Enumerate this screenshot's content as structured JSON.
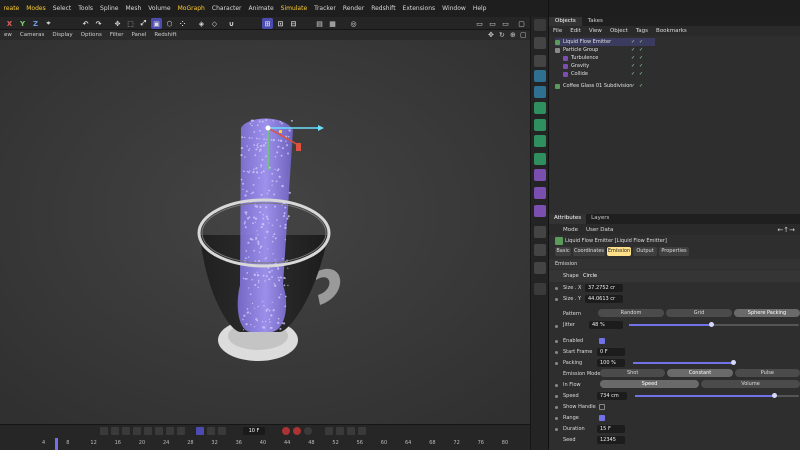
{
  "menubar": [
    "reate",
    "Modes",
    "Select",
    "Tools",
    "Spline",
    "Mesh",
    "Volume",
    "MoGraph",
    "Character",
    "Animate",
    "Simulate",
    "Tracker",
    "Render",
    "Redshift",
    "Extensions",
    "Window",
    "Help"
  ],
  "submenu": [
    "ew",
    "Cameras",
    "Display",
    "Options",
    "Filter",
    "Panel",
    "Redshift"
  ],
  "axis": {
    "x": "X",
    "y": "Y",
    "z": "Z"
  },
  "objects": {
    "tabs": [
      "Objects",
      "Takes"
    ],
    "menu": [
      "File",
      "Edit",
      "View",
      "Object",
      "Tags",
      "Bookmarks"
    ],
    "items": [
      {
        "name": "Liquid Flow Emitter",
        "selected": true
      },
      {
        "name": "Particle Group",
        "selected": false
      },
      {
        "name": "Turbulence",
        "selected": false
      },
      {
        "name": "Gravity",
        "selected": false
      },
      {
        "name": "Collide",
        "selected": false
      },
      {
        "name": "Coffee Glass 01 Subdivision",
        "selected": false
      }
    ]
  },
  "attributes": {
    "tabs": [
      "Attributes",
      "Layers"
    ],
    "menu": [
      "Mode",
      "User Data"
    ],
    "object_title": "Liquid Flow Emitter [Liquid Flow Emitter]",
    "section_tabs": [
      "Basic",
      "Coordinates",
      "Emission",
      "Output",
      "Properties"
    ],
    "active_section_tab": "Emission",
    "section_heading": "Emission",
    "shape_label": "Shape",
    "shape_value": "Circle",
    "size_x_label": "Size . X",
    "size_x_value": "37.2752 cr",
    "size_y_label": "Size . Y",
    "size_y_value": "44.0613 cr",
    "pattern_label": "Pattern",
    "pattern_options": [
      "Random",
      "Grid",
      "Sphere Packing"
    ],
    "pattern_selected": "Sphere Packing",
    "jitter_label": "Jitter",
    "jitter_value": "48 %",
    "jitter_fraction": 0.48,
    "enabled_label": "Enabled",
    "enabled": true,
    "start_frame_label": "Start Frame",
    "start_frame_value": "0 F",
    "packing_label": "Packing",
    "packing_value": "100 %",
    "packing_fraction": 1.0,
    "emission_mode_label": "Emission Mode",
    "emission_mode_options": [
      "Shot",
      "Constant",
      "Pulse"
    ],
    "emission_mode_selected": "Constant",
    "in_flow_label": "In Flow",
    "in_flow_options": [
      "Speed",
      "Volume"
    ],
    "in_flow_selected": "Speed",
    "speed_label": "Speed",
    "speed_value": "734 cm",
    "speed_fraction": 0.85,
    "show_handle_label": "Show Handle",
    "show_handle": false,
    "range_label": "Range",
    "range": true,
    "duration_label": "Duration",
    "duration_value": "15 F",
    "seed_label": "Seed",
    "seed_value": "12345"
  },
  "timeline": {
    "ticks": [
      "4",
      "8",
      "12",
      "16",
      "20",
      "24",
      "28",
      "32",
      "36",
      "40",
      "44",
      "48",
      "52",
      "56",
      "60",
      "64",
      "68",
      "72",
      "76",
      "80"
    ],
    "current_frame": "10 F"
  },
  "colors": {
    "accent": "#7272e8",
    "highlight": "#ffcc33",
    "particles": "#9a8cff"
  }
}
